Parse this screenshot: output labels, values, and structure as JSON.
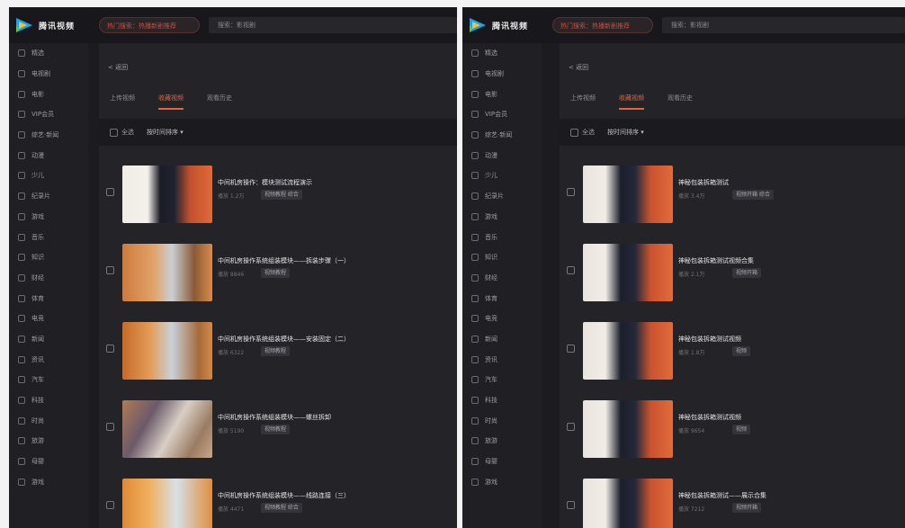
{
  "screens": [
    {
      "logo_text": "腾讯视频",
      "hot_search": "热门搜索：热播新剧推荐",
      "search_text": "搜索：影视剧",
      "sidebar": [
        "精选",
        "电视剧",
        "电影",
        "VIP会员",
        "综艺·新闻",
        "动漫",
        "少儿",
        "纪录片",
        "游戏",
        "音乐",
        "知识",
        "财经",
        "体育",
        "电竞",
        "新闻",
        "资讯",
        "汽车",
        "科技",
        "时尚",
        "旅游",
        "母婴",
        "游戏"
      ],
      "back_label": "< 返回",
      "tabs": [
        {
          "label": "上传视频",
          "active": false
        },
        {
          "label": "收藏视频",
          "active": true
        },
        {
          "label": "观看历史",
          "active": false
        }
      ],
      "select_all": "全选",
      "sort_label": "按时间排序 ▾",
      "videos": [
        {
          "title": "中间机房操作：模块测试流程演示",
          "meta": "播放 1.2万",
          "tag": "视频教程 综合"
        },
        {
          "title": "中间机房操作系统组装模块——拆装步骤（一）",
          "meta": "播放 8846",
          "tag": "视频教程"
        },
        {
          "title": "中间机房操作系统组装模块——安装固定（二）",
          "meta": "播放 6322",
          "tag": "视频教程"
        },
        {
          "title": "中间机房操作系统组装模块——螺丝拆卸",
          "meta": "播放 5190",
          "tag": "视频教程"
        },
        {
          "title": "中间机房操作系统组装模块——线路连接（三）",
          "meta": "播放 4471",
          "tag": "视频教程 综合"
        }
      ]
    },
    {
      "logo_text": "腾讯视频",
      "hot_search": "热门搜索：热播新剧推荐",
      "search_text": "搜索：影视剧",
      "sidebar": [
        "精选",
        "电视剧",
        "电影",
        "VIP会员",
        "综艺·新闻",
        "动漫",
        "少儿",
        "纪录片",
        "游戏",
        "音乐",
        "知识",
        "财经",
        "体育",
        "电竞",
        "新闻",
        "资讯",
        "汽车",
        "科技",
        "时尚",
        "旅游",
        "母婴",
        "游戏"
      ],
      "back_label": "< 返回",
      "tabs": [
        {
          "label": "上传视频",
          "active": false
        },
        {
          "label": "收藏视频",
          "active": true
        },
        {
          "label": "观看历史",
          "active": false
        }
      ],
      "select_all": "全选",
      "sort_label": "按时间排序 ▾",
      "videos": [
        {
          "title": "神秘包装拆箱测试",
          "meta": "播放 3.4万",
          "tag": "视频开箱 综合"
        },
        {
          "title": "神秘包装拆箱测试视频合集",
          "meta": "播放 2.1万",
          "tag": "视频开箱"
        },
        {
          "title": "神秘包装拆箱测试视频",
          "meta": "播放 1.8万",
          "tag": "视频"
        },
        {
          "title": "神秘包装拆箱测试视频",
          "meta": "播放 9654",
          "tag": "视频"
        },
        {
          "title": "神秘包装拆箱测试——展示合集",
          "meta": "播放 7212",
          "tag": "视频开箱"
        }
      ]
    }
  ],
  "colors": {
    "accent": "#e2653e",
    "background": "#1c1c20",
    "sidebar": "#1f1f24"
  }
}
